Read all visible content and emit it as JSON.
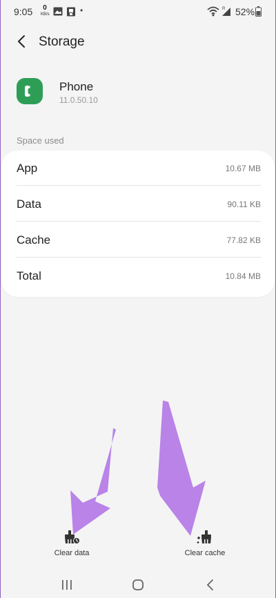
{
  "status_bar": {
    "time": "9:05",
    "net_speed_value": "0",
    "net_speed_unit": "KB/s",
    "dot": "•",
    "battery_percent": "52%"
  },
  "header": {
    "title": "Storage"
  },
  "app": {
    "name": "Phone",
    "version": "11.0.50.10",
    "icon": "phone-app-icon",
    "icon_color": "#2e9e57"
  },
  "space_used": {
    "label": "Space used",
    "rows": [
      {
        "label": "App",
        "value": "10.67 MB"
      },
      {
        "label": "Data",
        "value": "90.11 KB"
      },
      {
        "label": "Cache",
        "value": "77.82 KB"
      },
      {
        "label": "Total",
        "value": "10.84 MB"
      }
    ]
  },
  "actions": {
    "clear_data": "Clear data",
    "clear_cache": "Clear cache"
  },
  "annotation_color": "#b983e8"
}
